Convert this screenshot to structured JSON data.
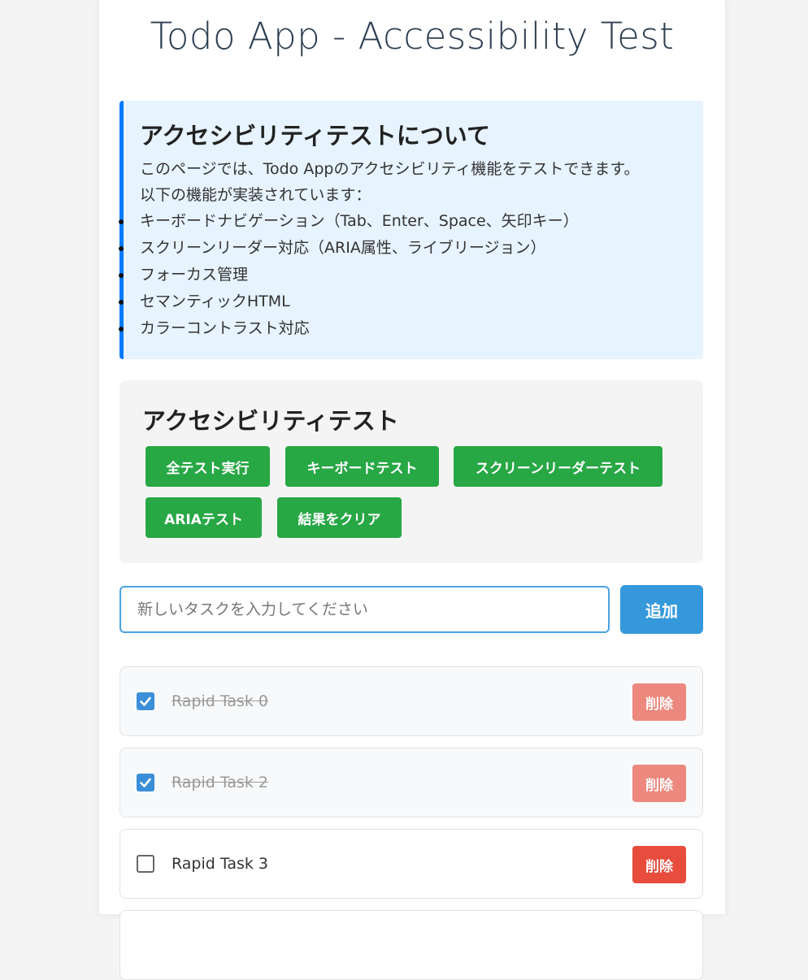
{
  "header": {
    "title": "Todo App - Accessibility Test"
  },
  "info": {
    "heading": "アクセシビリティテストについて",
    "description": "このページでは、Todo Appのアクセシビリティ機能をテストできます。",
    "list_intro": "以下の機能が実装されています：",
    "features": [
      "キーボードナビゲーション（Tab、Enter、Space、矢印キー）",
      "スクリーンリーダー対応（ARIA属性、ライブリージョン）",
      "フォーカス管理",
      "セマンティックHTML",
      "カラーコントラスト対応"
    ]
  },
  "tests": {
    "heading": "アクセシビリティテスト",
    "buttons": [
      "全テスト実行",
      "キーボードテスト",
      "スクリーンリーダーテスト",
      "ARIAテスト",
      "結果をクリア"
    ]
  },
  "input": {
    "value": "",
    "placeholder": "新しいタスクを入力してください",
    "add_label": "追加"
  },
  "todos": [
    {
      "text": "Rapid Task 0",
      "completed": true,
      "delete_label": "削除"
    },
    {
      "text": "Rapid Task 2",
      "completed": true,
      "delete_label": "削除"
    },
    {
      "text": "Rapid Task 3",
      "completed": false,
      "delete_label": "削除"
    }
  ],
  "colors": {
    "info_accent": "#007bff",
    "info_background": "#e7f3ff",
    "test_button": "#28a745",
    "add_button": "#3498db",
    "delete_button": "#e74c3c",
    "checkbox_checked": "#3a8fd8"
  }
}
